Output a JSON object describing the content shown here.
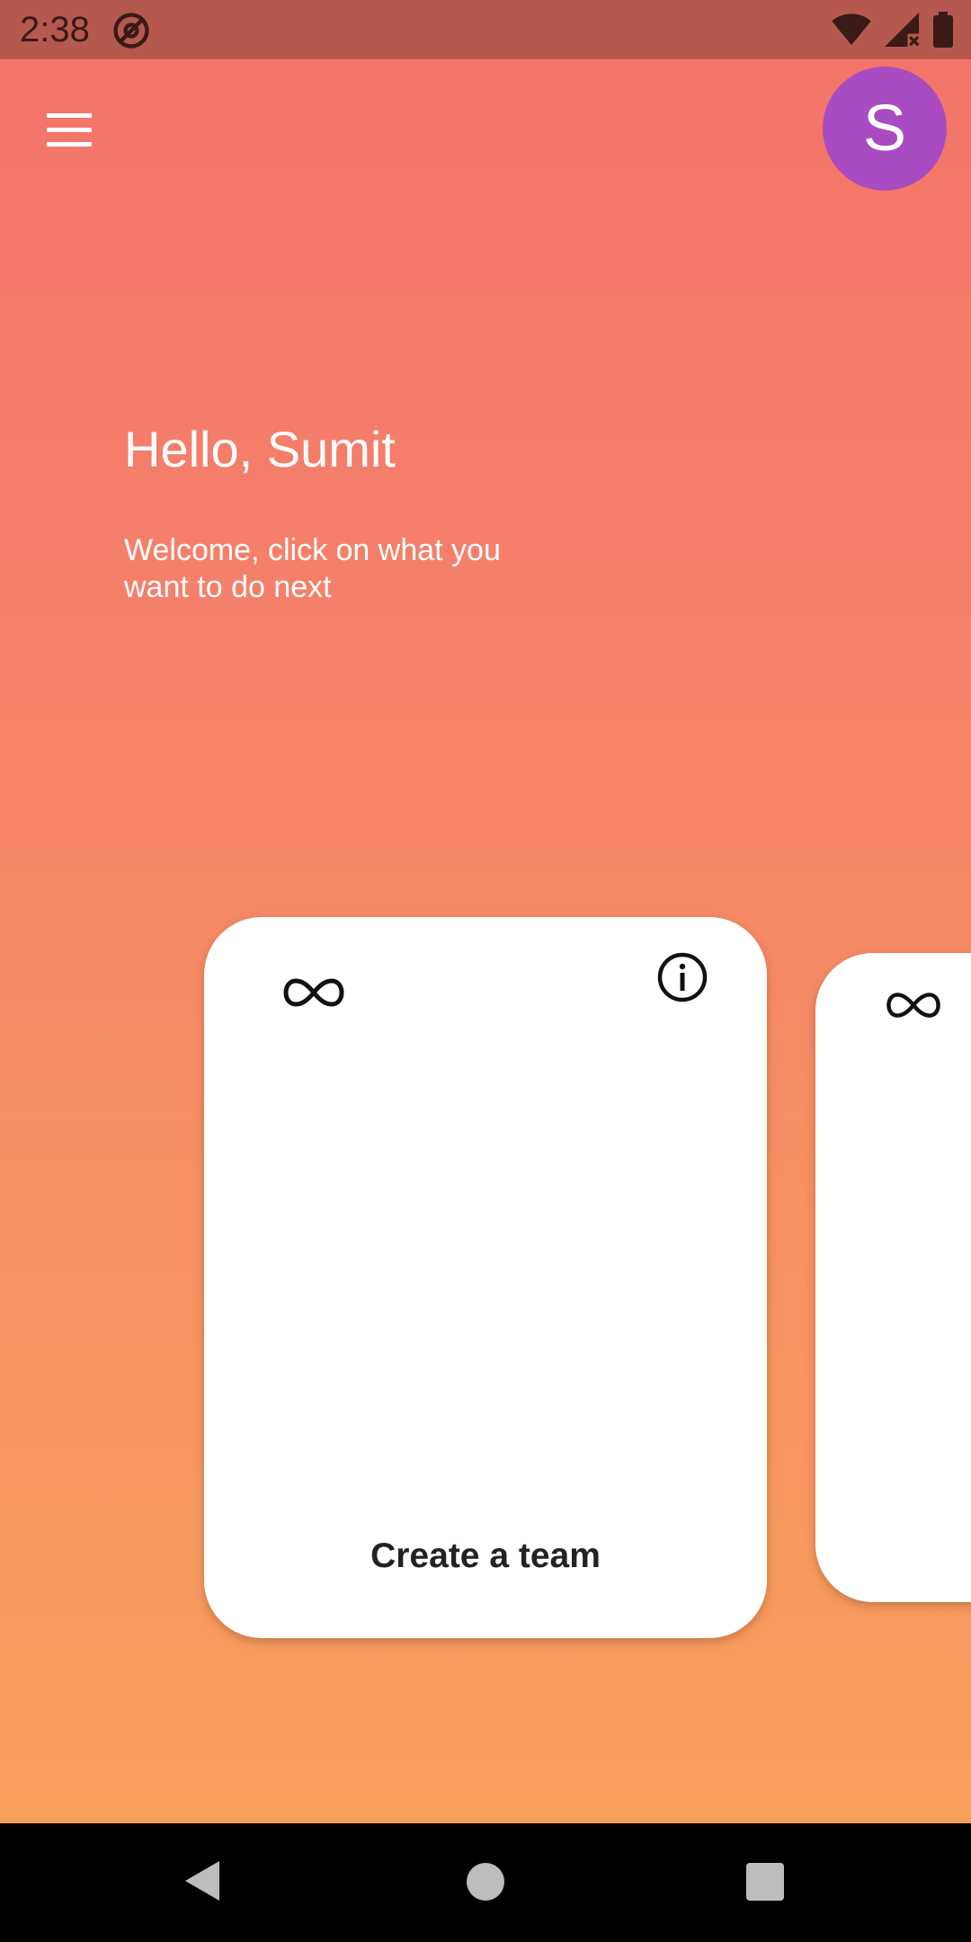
{
  "status_bar": {
    "time": "2:38",
    "icons": [
      "at-sign-icon",
      "wifi-icon",
      "signal-no-data-icon",
      "battery-icon"
    ]
  },
  "header": {
    "menu_icon": "hamburger-menu-icon",
    "avatar_initial": "S",
    "avatar_color": "#a94cc2"
  },
  "main": {
    "greeting": "Hello, Sumit",
    "welcome_text": "Welcome, click on what you want to do next"
  },
  "cards": [
    {
      "title": "Create a team",
      "icons": [
        "infinity-icon",
        "info-icon"
      ]
    },
    {
      "title": "",
      "icons": [
        "infinity-icon"
      ]
    }
  ],
  "nav_bar": {
    "icons": [
      "back-icon",
      "home-icon",
      "recents-icon"
    ]
  },
  "colors": {
    "gradient_top": "#f4736a",
    "gradient_bottom": "#f7a15c",
    "status_bar": "#b5584e",
    "card": "#ffffff"
  }
}
